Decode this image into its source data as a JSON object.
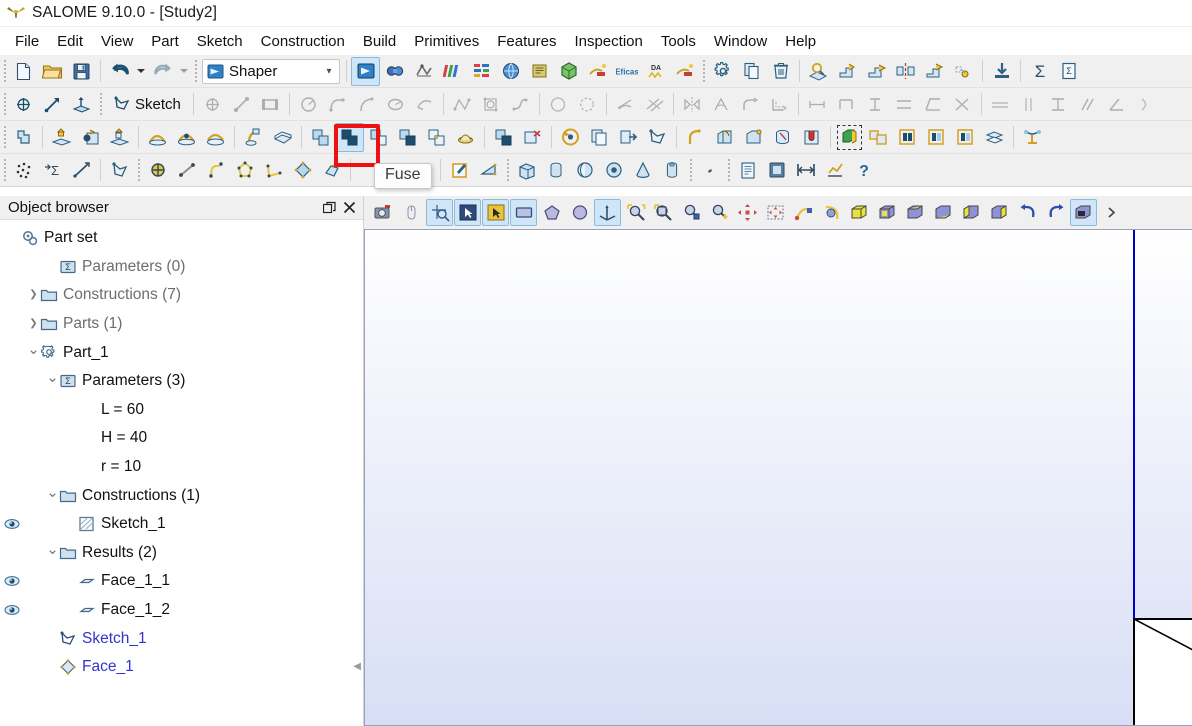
{
  "window": {
    "title": "SALOME 9.10.0 - [Study2]",
    "app_icon": "salome-logo-icon"
  },
  "menubar": {
    "items": [
      {
        "label": "File"
      },
      {
        "label": "Edit"
      },
      {
        "label": "View"
      },
      {
        "label": "Part"
      },
      {
        "label": "Sketch"
      },
      {
        "label": "Construction"
      },
      {
        "label": "Build"
      },
      {
        "label": "Primitives"
      },
      {
        "label": "Features"
      },
      {
        "label": "Inspection"
      },
      {
        "label": "Tools"
      },
      {
        "label": "Window"
      },
      {
        "label": "Help"
      }
    ]
  },
  "toolbars": {
    "standard": {
      "new_label": "New",
      "open_label": "Open",
      "save_label": "Save",
      "undo_label": "Undo",
      "redo_label": "Redo",
      "module_combo_value": "Shaper",
      "module_combo_placeholder": "Shaper"
    },
    "sketch": {
      "sketch_button_label": "Sketch"
    },
    "tooltip": {
      "text": "Fuse",
      "for_button": "fuse-button"
    },
    "highlight": {
      "color": "#ee1111",
      "target": "fuse-button"
    }
  },
  "object_browser": {
    "title": "Object browser",
    "undock_label": "Undock",
    "close_label": "Close",
    "tree": [
      {
        "label": "Part set",
        "indent": 0,
        "twisty": "",
        "icon": "part-set-icon",
        "style": "normal",
        "eye": false
      },
      {
        "label": "Parameters (0)",
        "indent": 2,
        "twisty": "",
        "icon": "parameters-icon",
        "style": "gray",
        "eye": false
      },
      {
        "label": "Constructions (7)",
        "indent": 1,
        "twisty": ">",
        "icon": "folder-icon",
        "style": "gray",
        "eye": false
      },
      {
        "label": "Parts (1)",
        "indent": 1,
        "twisty": ">",
        "icon": "folder-icon",
        "style": "gray",
        "eye": false
      },
      {
        "label": "Part_1",
        "indent": 1,
        "twisty": "v",
        "icon": "part-icon",
        "style": "normal",
        "eye": false
      },
      {
        "label": "Parameters (3)",
        "indent": 2,
        "twisty": "v",
        "icon": "parameters-icon",
        "style": "normal",
        "eye": false
      },
      {
        "label": "L = 60",
        "indent": 3,
        "twisty": "",
        "icon": "none",
        "style": "normal",
        "eye": false
      },
      {
        "label": "H = 40",
        "indent": 3,
        "twisty": "",
        "icon": "none",
        "style": "normal",
        "eye": false
      },
      {
        "label": "r = 10",
        "indent": 3,
        "twisty": "",
        "icon": "none",
        "style": "normal",
        "eye": false
      },
      {
        "label": "Constructions (1)",
        "indent": 2,
        "twisty": "v",
        "icon": "folder-icon",
        "style": "normal",
        "eye": false
      },
      {
        "label": "Sketch_1",
        "indent": 3,
        "twisty": "",
        "icon": "sketch-result-icon",
        "style": "normal",
        "eye": true
      },
      {
        "label": "Results (2)",
        "indent": 2,
        "twisty": "v",
        "icon": "folder-icon",
        "style": "normal",
        "eye": false
      },
      {
        "label": "Face_1_1",
        "indent": 3,
        "twisty": "",
        "icon": "face-result-icon",
        "style": "normal",
        "eye": true
      },
      {
        "label": "Face_1_2",
        "indent": 3,
        "twisty": "",
        "icon": "face-result-icon",
        "style": "normal",
        "eye": true
      },
      {
        "label": "Sketch_1",
        "indent": 2,
        "twisty": "",
        "icon": "sketch-feature-icon",
        "style": "blue",
        "eye": false
      },
      {
        "label": "Face_1",
        "indent": 2,
        "twisty": "",
        "icon": "face-feature-icon",
        "style": "blue",
        "eye": false
      }
    ]
  },
  "viewport": {
    "background_top": "#ffffff",
    "background_bottom": "#d8def5",
    "axis_color": "#0000cc",
    "shape_fill": "#ffffff",
    "shape_stroke": "#000000"
  },
  "icons": {
    "new": "new-document-icon",
    "open": "open-folder-icon",
    "save": "save-disk-icon",
    "undo": "undo-arrow-icon",
    "redo": "redo-arrow-icon",
    "shaper": "shaper-module-icon",
    "geometry": "geometry-module-icon",
    "mesh": "mesh-module-icon",
    "para": "paravis-module-icon",
    "yacs": "yacs-module-icon",
    "jobmanager": "jobmanager-module-icon",
    "notebook": "notebook-icon",
    "hexablock": "hexablock-icon",
    "homard": "homard-icon",
    "eficas": "eficas-icon",
    "dymola": "dymola-icon",
    "openturns": "openturns-icon",
    "settings": "gear-icon",
    "copy": "copy-icon",
    "delete": "trash-icon",
    "inspect": "inspect-icon",
    "export": "export-icon",
    "sum": "sigma-icon",
    "report": "report-icon",
    "point": "point-icon",
    "axis": "axis-icon",
    "plane": "plane-icon",
    "sketch": "sketch-icon",
    "line": "line-icon",
    "rectangle": "rectangle-icon",
    "circle": "circle-icon",
    "arc": "arc-icon",
    "fuse": "fuse-boolean-icon",
    "cut": "cut-boolean-icon",
    "common": "common-boolean-icon",
    "box": "box-primitive-icon",
    "cylinder": "cylinder-primitive-icon",
    "sphere": "sphere-primitive-icon",
    "torus": "torus-primitive-icon",
    "cone": "cone-primitive-icon",
    "tube": "tube-primitive-icon",
    "dump": "dump-view-icon",
    "mouse": "mouse-mode-icon",
    "selection_point": "select-point-icon",
    "selection_edge": "select-edge-icon",
    "selection_face": "select-face-icon",
    "selection_solid": "select-solid-icon",
    "fit_all": "fit-all-icon",
    "fit_area": "fit-area-icon",
    "zoom": "zoom-icon",
    "pan": "pan-icon",
    "global_pan": "global-pan-icon",
    "rotate": "rotate-icon",
    "front": "front-view-icon",
    "back": "back-view-icon",
    "top": "top-view-icon",
    "bottom": "bottom-view-icon",
    "left": "left-view-icon",
    "right": "right-view-icon",
    "anticlock": "rotate-ccw-icon",
    "clock": "rotate-cw-icon",
    "reset": "reset-view-icon",
    "eye": "visibility-eye-icon",
    "folder": "folder-icon",
    "close": "close-icon",
    "undock": "undock-icon",
    "chevron_right": "chevron-right-icon",
    "chevron_down": "chevron-down-icon"
  }
}
